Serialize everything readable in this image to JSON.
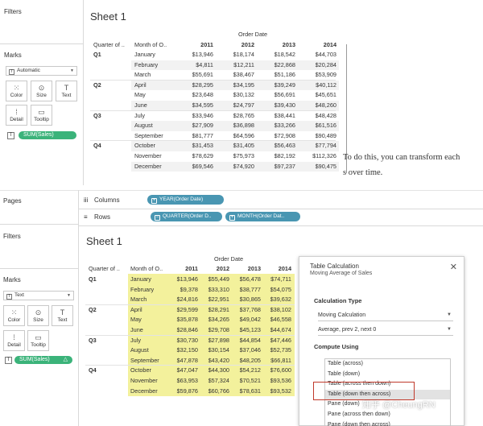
{
  "top": {
    "filters_label": "Filters",
    "marks_label": "Marks",
    "mark_type": "Automatic",
    "mark_buttons": [
      "Color",
      "Size",
      "Text",
      "Detail",
      "Tooltip"
    ],
    "measure_pill": "SUM(Sales)",
    "sheet_title": "Sheet 1",
    "col_group_header": "Order Date",
    "row_headers": [
      "Quarter of ..",
      "Month of O.."
    ],
    "years": [
      "2011",
      "2012",
      "2013",
      "2014"
    ],
    "quarters": [
      "Q1",
      "Q2",
      "Q3",
      "Q4"
    ],
    "rows": [
      {
        "month": "January",
        "values": [
          "$13,946",
          "$18,174",
          "$18,542",
          "$44,703"
        ]
      },
      {
        "month": "February",
        "values": [
          "$4,811",
          "$12,211",
          "$22,868",
          "$20,284"
        ]
      },
      {
        "month": "March",
        "values": [
          "$55,691",
          "$38,467",
          "$51,186",
          "$53,909"
        ]
      },
      {
        "month": "April",
        "values": [
          "$28,295",
          "$34,195",
          "$39,249",
          "$40,112"
        ]
      },
      {
        "month": "May",
        "values": [
          "$23,648",
          "$30,132",
          "$56,691",
          "$45,651"
        ]
      },
      {
        "month": "June",
        "values": [
          "$34,595",
          "$24,797",
          "$39,430",
          "$48,260"
        ]
      },
      {
        "month": "July",
        "values": [
          "$33,946",
          "$28,765",
          "$38,441",
          "$48,428"
        ]
      },
      {
        "month": "August",
        "values": [
          "$27,909",
          "$36,898",
          "$33,266",
          "$61,516"
        ]
      },
      {
        "month": "September",
        "values": [
          "$81,777",
          "$64,596",
          "$72,908",
          "$90,489"
        ]
      },
      {
        "month": "October",
        "values": [
          "$31,453",
          "$31,405",
          "$56,463",
          "$77,794"
        ]
      },
      {
        "month": "November",
        "values": [
          "$78,629",
          "$75,973",
          "$82,192",
          "$112,326"
        ]
      },
      {
        "month": "December",
        "values": [
          "$69,546",
          "$74,920",
          "$97,237",
          "$90,475"
        ]
      }
    ]
  },
  "overlay_text": [
    "To do this, you can transform each",
    "s over time."
  ],
  "bottom": {
    "pages_label": "Pages",
    "filters_label": "Filters",
    "marks_label": "Marks",
    "mark_type": "Text",
    "mark_buttons": [
      "Color",
      "Size",
      "Text",
      "Detail",
      "Tooltip"
    ],
    "measure_pill": "SUM(Sales)",
    "measure_delta": "△",
    "columns_label": "Columns",
    "rows_label": "Rows",
    "columns_pill": "YEAR(Order Date)",
    "rows_pills": [
      "QUARTER(Order D..",
      "MONTH(Order Dat.."
    ],
    "sheet_title": "Sheet 1",
    "col_group_header": "Order Date",
    "row_headers": [
      "Quarter of ..",
      "Month of O.."
    ],
    "years": [
      "2011",
      "2012",
      "2013",
      "2014"
    ],
    "quarters": [
      "Q1",
      "Q2",
      "Q3",
      "Q4"
    ],
    "highlight_color": "#f3f19c",
    "rows": [
      {
        "month": "January",
        "values": [
          "$13,946",
          "$55,449",
          "$56,478",
          "$74,711"
        ]
      },
      {
        "month": "February",
        "values": [
          "$9,378",
          "$33,310",
          "$38,777",
          "$54,075"
        ]
      },
      {
        "month": "March",
        "values": [
          "$24,816",
          "$22,951",
          "$30,865",
          "$39,632"
        ]
      },
      {
        "month": "April",
        "values": [
          "$29,599",
          "$28,291",
          "$37,768",
          "$38,102"
        ]
      },
      {
        "month": "May",
        "values": [
          "$35,878",
          "$34,265",
          "$49,042",
          "$46,558"
        ]
      },
      {
        "month": "June",
        "values": [
          "$28,846",
          "$29,708",
          "$45,123",
          "$44,674"
        ]
      },
      {
        "month": "July",
        "values": [
          "$30,730",
          "$27,898",
          "$44,854",
          "$47,446"
        ]
      },
      {
        "month": "August",
        "values": [
          "$32,150",
          "$30,154",
          "$37,046",
          "$52,735"
        ]
      },
      {
        "month": "September",
        "values": [
          "$47,878",
          "$43,420",
          "$48,205",
          "$66,811"
        ]
      },
      {
        "month": "October",
        "values": [
          "$47,047",
          "$44,300",
          "$54,212",
          "$76,600"
        ]
      },
      {
        "month": "November",
        "values": [
          "$63,953",
          "$57,324",
          "$70,521",
          "$93,536"
        ]
      },
      {
        "month": "December",
        "values": [
          "$59,876",
          "$60,766",
          "$78,631",
          "$93,532"
        ]
      }
    ]
  },
  "calc_panel": {
    "title": "Table Calculation",
    "subtitle": "Moving Average of Sales",
    "calc_type_label": "Calculation Type",
    "calc_type_value": "Moving Calculation",
    "summary_value": "Average, prev 2, next 0",
    "compute_using_label": "Compute Using",
    "options": [
      "Table (across)",
      "Table (down)",
      "Table (across then down)",
      "Table (down then across)",
      "Pane (down)",
      "Pane (across then down)",
      "Pane (down then across)"
    ],
    "selected_index": 3
  },
  "watermark": "知乎 @CheungRN"
}
